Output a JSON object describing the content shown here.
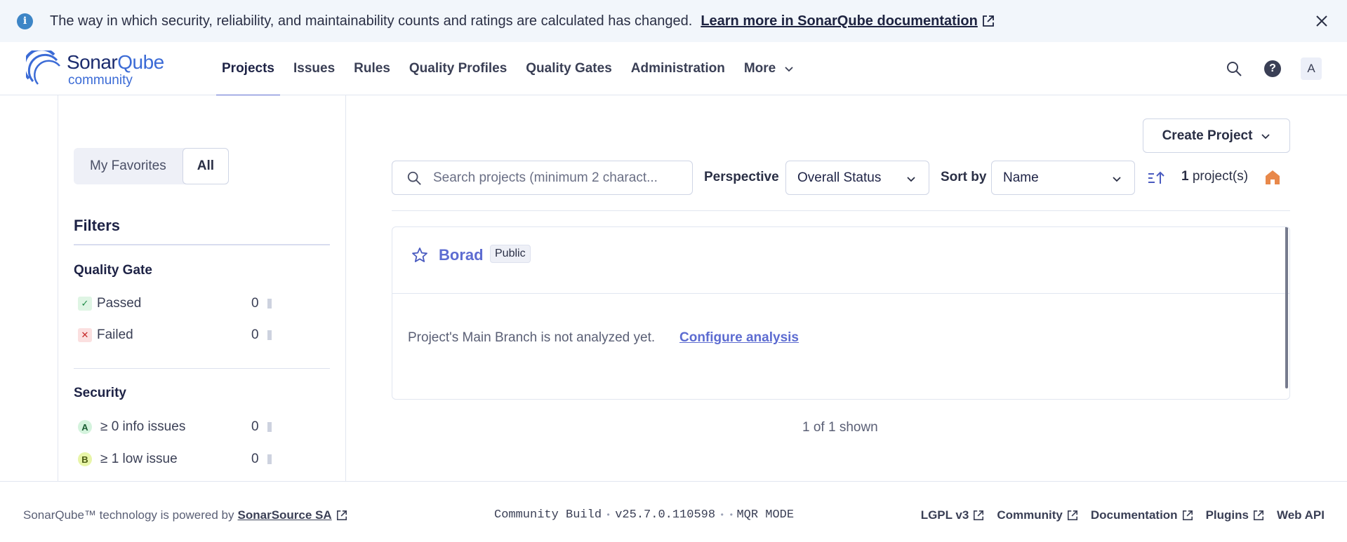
{
  "banner": {
    "message": "The way in which security, reliability, and maintainability counts and ratings are calculated has changed.",
    "link": "Learn more in SonarQube documentation"
  },
  "logo": {
    "brand_a": "Sonar",
    "brand_b": "Qube",
    "edition": "community"
  },
  "nav": {
    "items": [
      {
        "label": "Projects",
        "active": true
      },
      {
        "label": "Issues"
      },
      {
        "label": "Rules"
      },
      {
        "label": "Quality Profiles"
      },
      {
        "label": "Quality Gates"
      },
      {
        "label": "Administration"
      },
      {
        "label": "More"
      }
    ],
    "avatar": "A"
  },
  "sidebar": {
    "toggle": {
      "favorites": "My Favorites",
      "all": "All"
    },
    "filters_title": "Filters",
    "quality_gate": {
      "title": "Quality Gate",
      "items": [
        {
          "label": "Passed",
          "count": "0"
        },
        {
          "label": "Failed",
          "count": "0"
        }
      ]
    },
    "security": {
      "title": "Security",
      "items": [
        {
          "rating": "A",
          "label": "≥ 0 info issues",
          "count": "0"
        },
        {
          "rating": "B",
          "label": "≥ 1 low issue",
          "count": "0"
        }
      ]
    }
  },
  "main": {
    "create_button": "Create Project",
    "search_placeholder": "Search projects (minimum 2 charact...",
    "perspective_label": "Perspective",
    "perspective_value": "Overall Status",
    "sort_label": "Sort by",
    "sort_value": "Name",
    "count_number": "1",
    "count_suffix": " project(s)",
    "project": {
      "name": "Borad",
      "visibility": "Public",
      "notice": "Project's Main Branch is not analyzed yet.",
      "action": "Configure analysis"
    },
    "shown": "1 of 1 shown"
  },
  "footer": {
    "powered_prefix": "SonarQube™ technology is powered by",
    "powered_link": "SonarSource SA",
    "build": "Community Build",
    "version": "v25.7.0.110598",
    "mode": "MQR MODE",
    "links": [
      "LGPL v3",
      "Community",
      "Documentation",
      "Plugins",
      "Web API"
    ]
  },
  "colors": {
    "accent": "#5d6cd1",
    "banner_bg": "#f2f6fb",
    "passed": "#dff5e4",
    "failed": "#fbe0e0",
    "rating_a": "#d4f3dd",
    "rating_b": "#e8f5a8",
    "home": "#e8884a"
  }
}
